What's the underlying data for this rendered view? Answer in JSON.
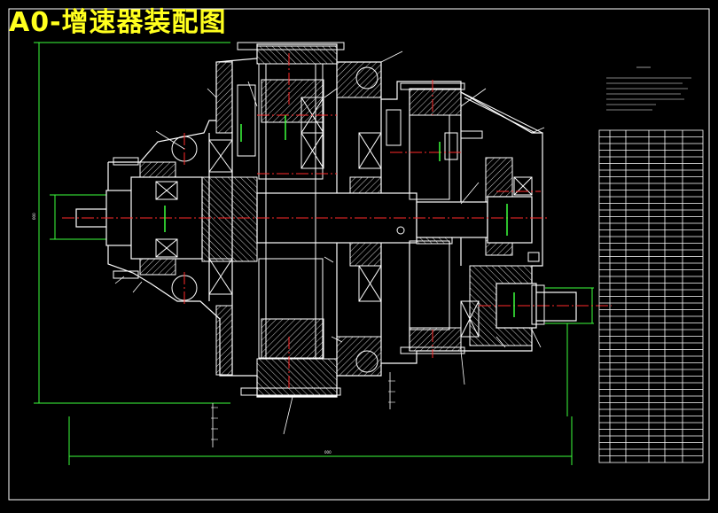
{
  "title": "A0-增速器装配图",
  "colors": {
    "background": "#000000",
    "title": "#ffff1e",
    "outline": "#ffffff",
    "hatch": "#ffffff",
    "centerline": "#ff2a2a",
    "dimension": "#3cff3c",
    "keyline": "#ff30ff",
    "frame": "#ffffff"
  },
  "icons": [
    "gear-assembly-section",
    "bill-of-materials-table"
  ]
}
